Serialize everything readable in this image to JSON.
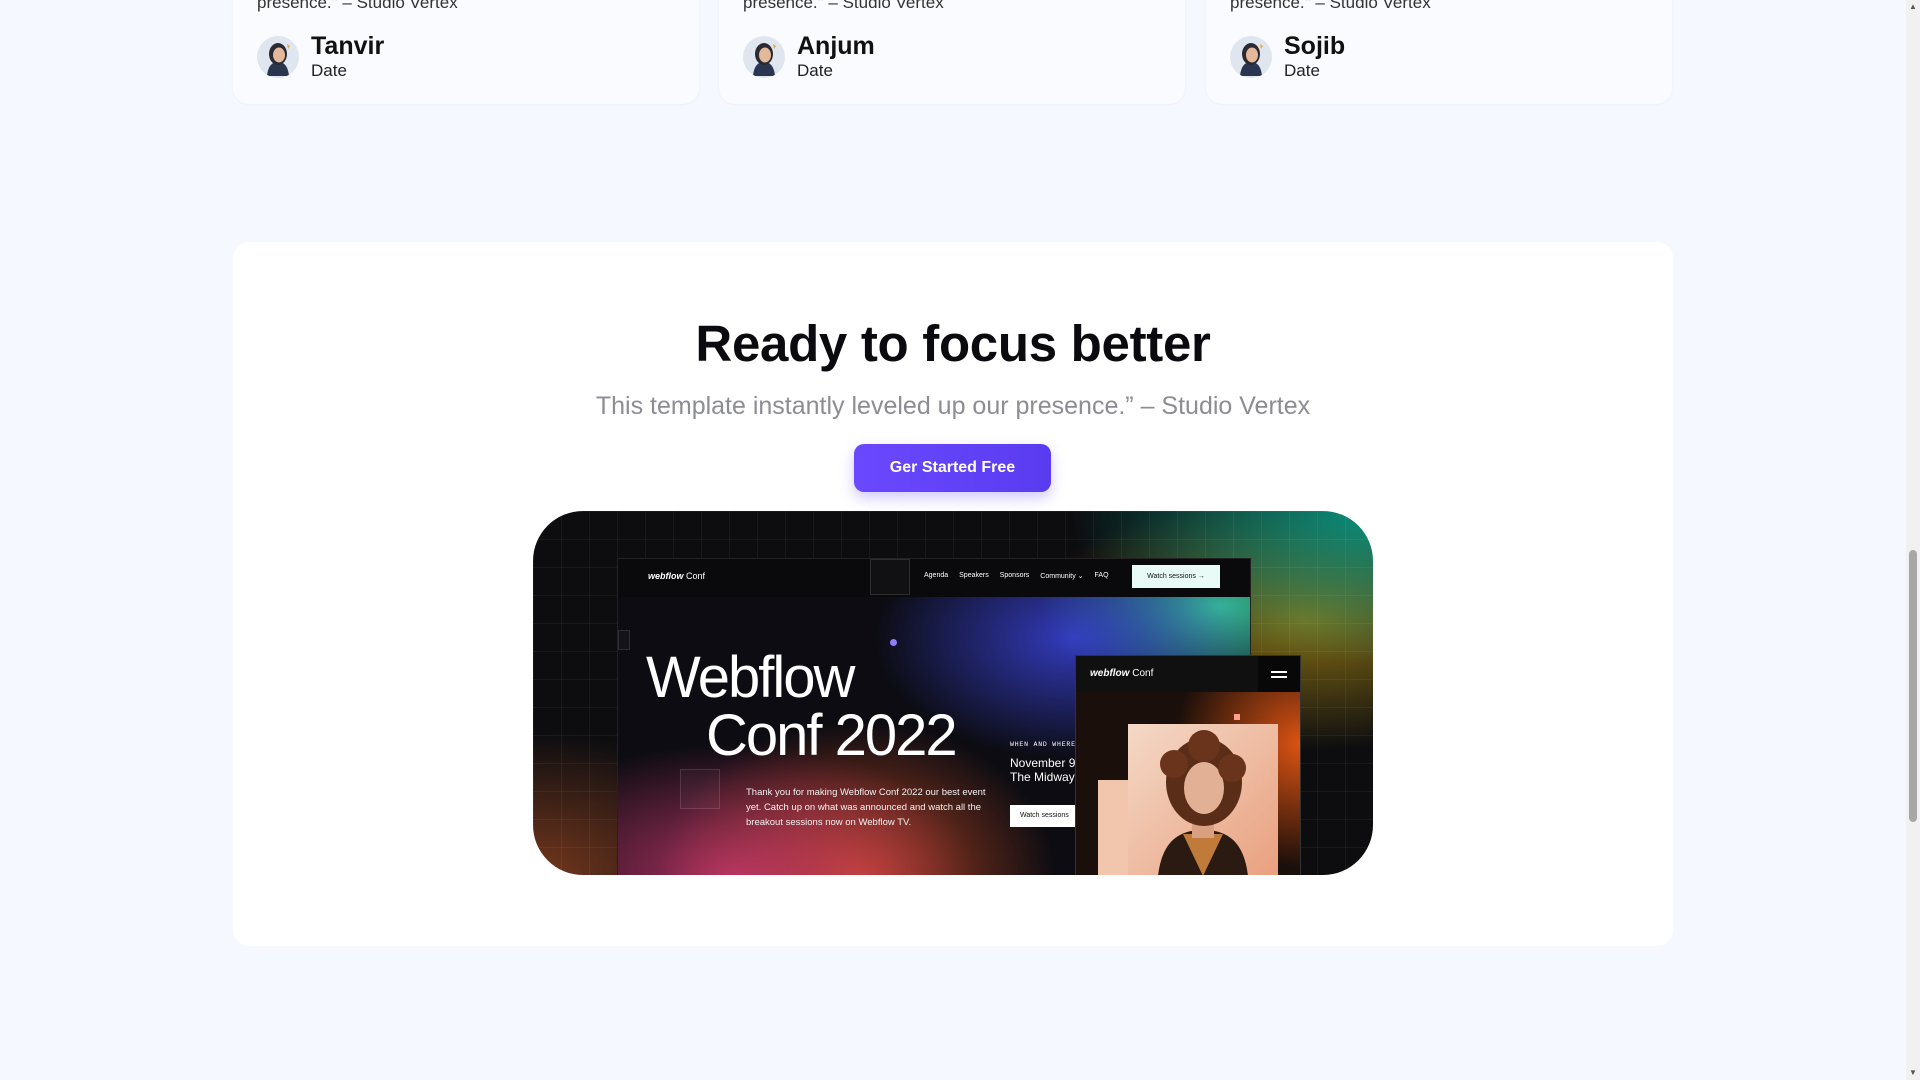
{
  "testimonials": [
    {
      "quote": "presence.\" – Studio Vertex",
      "name": "Tanvir",
      "date": "Date"
    },
    {
      "quote": "presence.\" – Studio Vertex",
      "name": "Anjum",
      "date": "Date"
    },
    {
      "quote": "presence.\" – Studio Vertex",
      "name": "Sojib",
      "date": "Date"
    }
  ],
  "cta": {
    "title": "Ready to focus better",
    "subtitle": "This template instantly leveled up our presence.” – Studio Vertex",
    "button_label": "Ger Started Free"
  },
  "hero_mock": {
    "logo_brand": "webflow",
    "logo_suffix": "Conf",
    "nav": [
      "Agenda",
      "Speakers",
      "Sponsors",
      "Community ⌄",
      "FAQ"
    ],
    "watch_label": "Watch sessions  →",
    "title_line1": "Webflow",
    "title_line2": "Conf 2022",
    "blurb": "Thank you for making Webflow Conf 2022 our best event yet. Catch up on what was announced and watch all the breakout sessions now on Webflow TV.",
    "when_label": "WHEN AND WHERE",
    "when_value_line1": "November 9",
    "when_value_line2": "The Midway",
    "watch_small_label": "Watch sessions"
  },
  "colors": {
    "page_bg": "#f5f8fe",
    "button": "#5a3cf0",
    "subtitle": "#8c8c94"
  }
}
